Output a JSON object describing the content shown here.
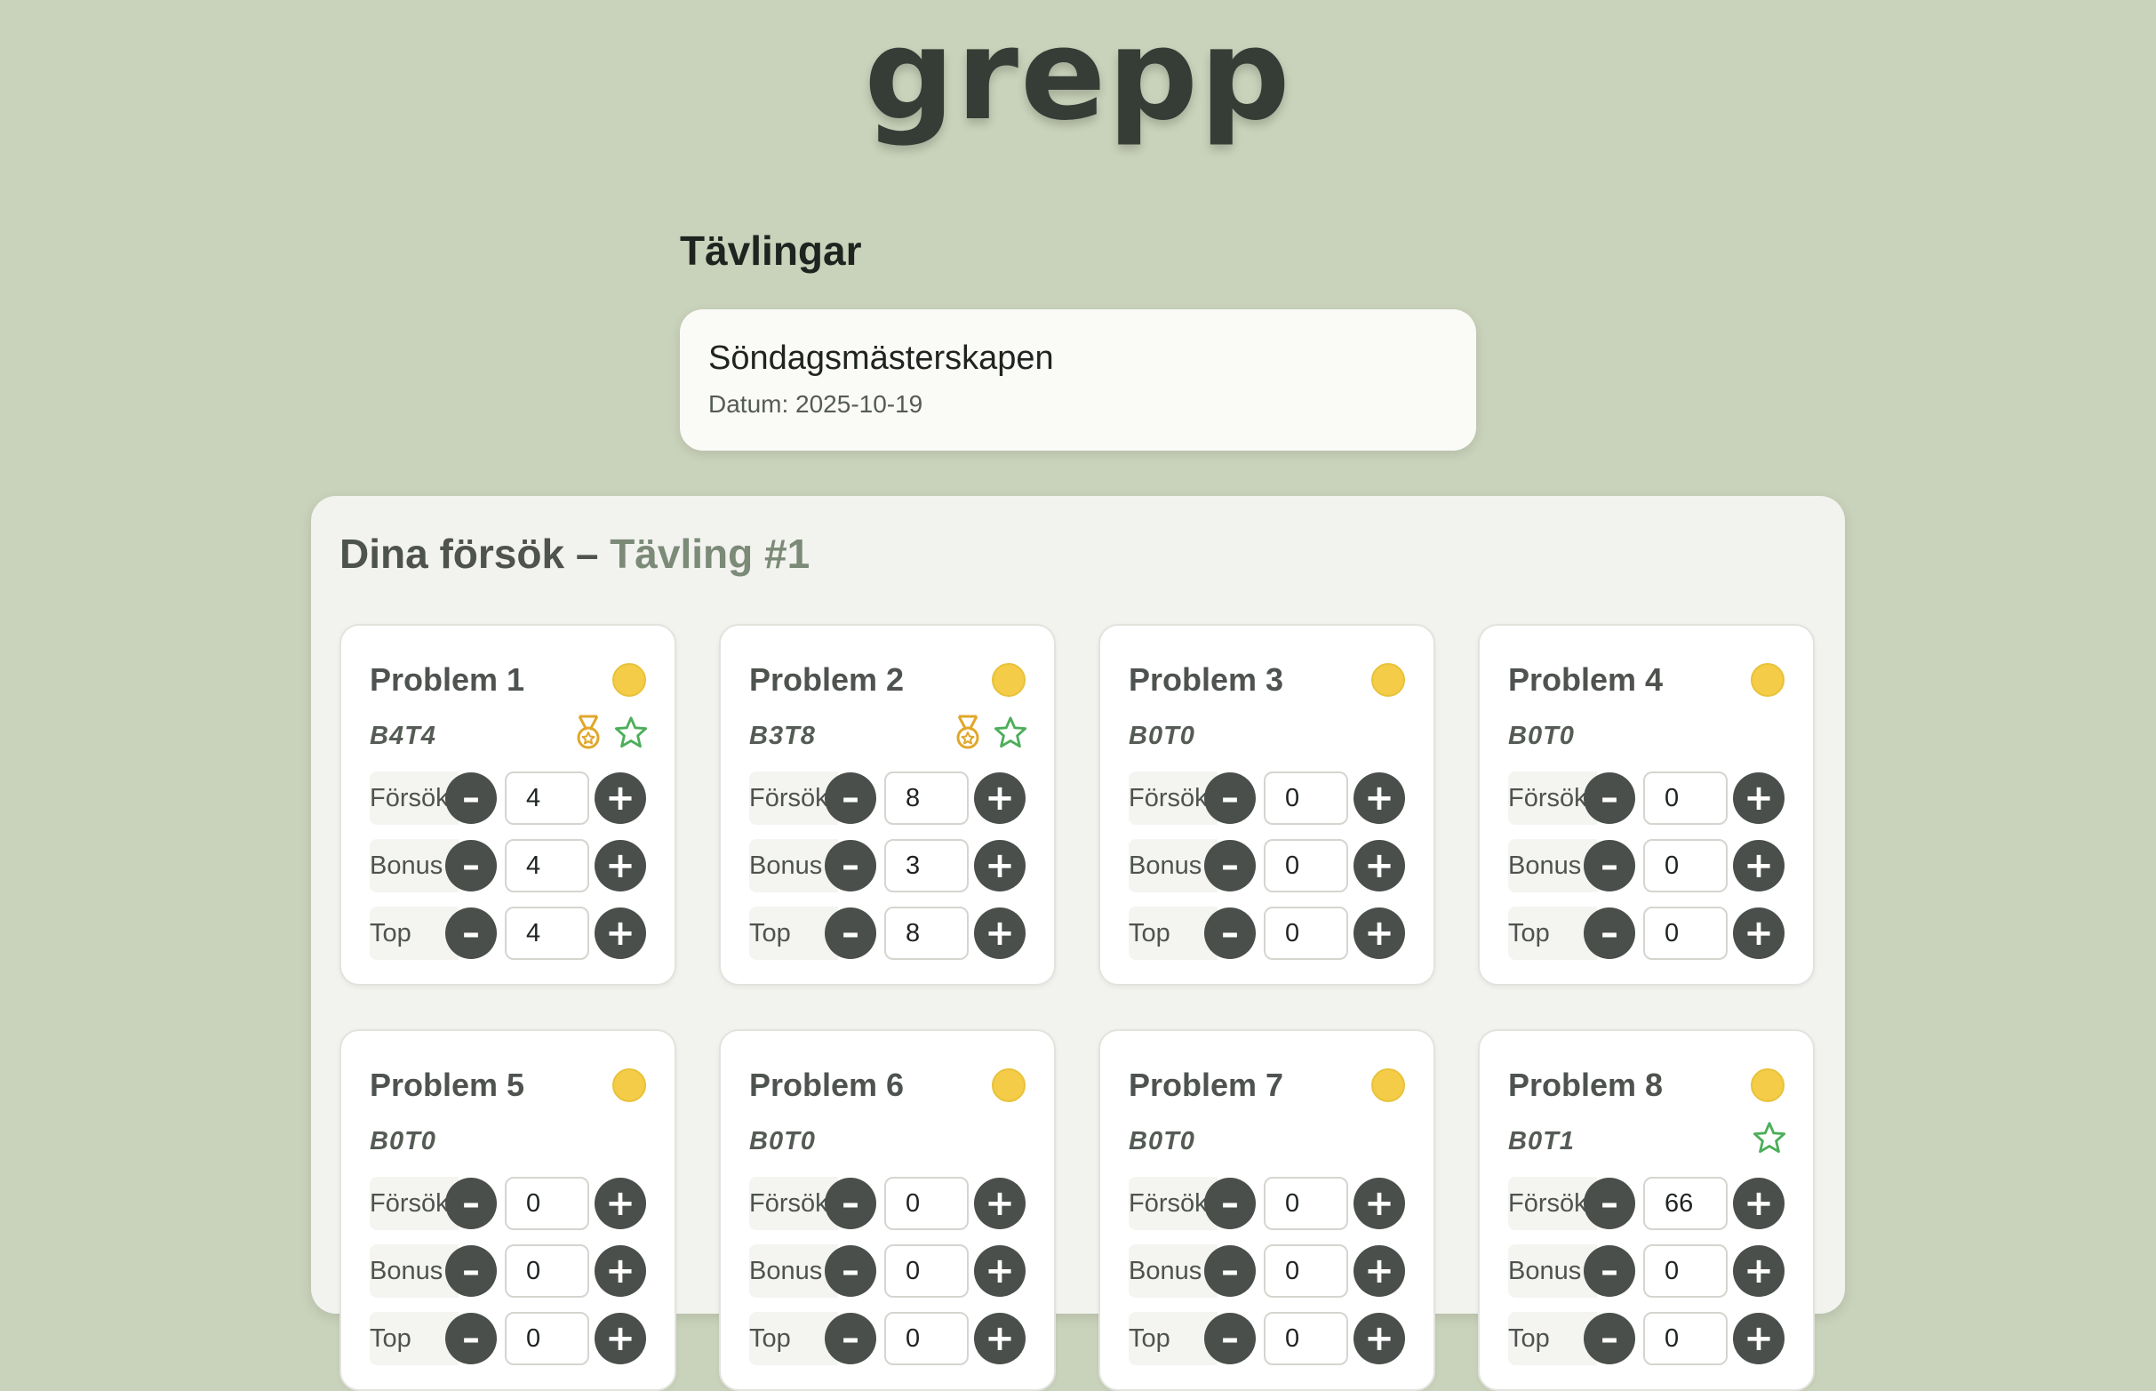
{
  "app": {
    "logo": "grepp"
  },
  "competitions": {
    "title": "Tävlingar",
    "items": [
      {
        "name": "Söndagsmästerskapen",
        "date": "Datum: 2025-10-19"
      }
    ]
  },
  "attempts": {
    "title_prefix": "Dina försök – ",
    "title_accent": "Tävling #1",
    "labels": {
      "forsok": "Försök",
      "bonus": "Bonus",
      "top": "Top"
    },
    "minus_glyph": "–",
    "plus_glyph": "+",
    "colors": {
      "status_dot": "#f4cc47",
      "medal": "#e0a72a",
      "star": "#4cae5a"
    },
    "problems": [
      {
        "name": "Problem 1",
        "code": "B4T4",
        "forsok": "4",
        "bonus": "4",
        "top": "4",
        "medal": true,
        "star": true
      },
      {
        "name": "Problem 2",
        "code": "B3T8",
        "forsok": "8",
        "bonus": "3",
        "top": "8",
        "medal": true,
        "star": true
      },
      {
        "name": "Problem 3",
        "code": "B0T0",
        "forsok": "0",
        "bonus": "0",
        "top": "0",
        "medal": false,
        "star": false
      },
      {
        "name": "Problem 4",
        "code": "B0T0",
        "forsok": "0",
        "bonus": "0",
        "top": "0",
        "medal": false,
        "star": false
      },
      {
        "name": "Problem 5",
        "code": "B0T0",
        "forsok": "0",
        "bonus": "0",
        "top": "0",
        "medal": false,
        "star": false
      },
      {
        "name": "Problem 6",
        "code": "B0T0",
        "forsok": "0",
        "bonus": "0",
        "top": "0",
        "medal": false,
        "star": false
      },
      {
        "name": "Problem 7",
        "code": "B0T0",
        "forsok": "0",
        "bonus": "0",
        "top": "0",
        "medal": false,
        "star": false
      },
      {
        "name": "Problem 8",
        "code": "B0T1",
        "forsok": "66",
        "bonus": "0",
        "top": "0",
        "medal": false,
        "star": true
      }
    ]
  }
}
